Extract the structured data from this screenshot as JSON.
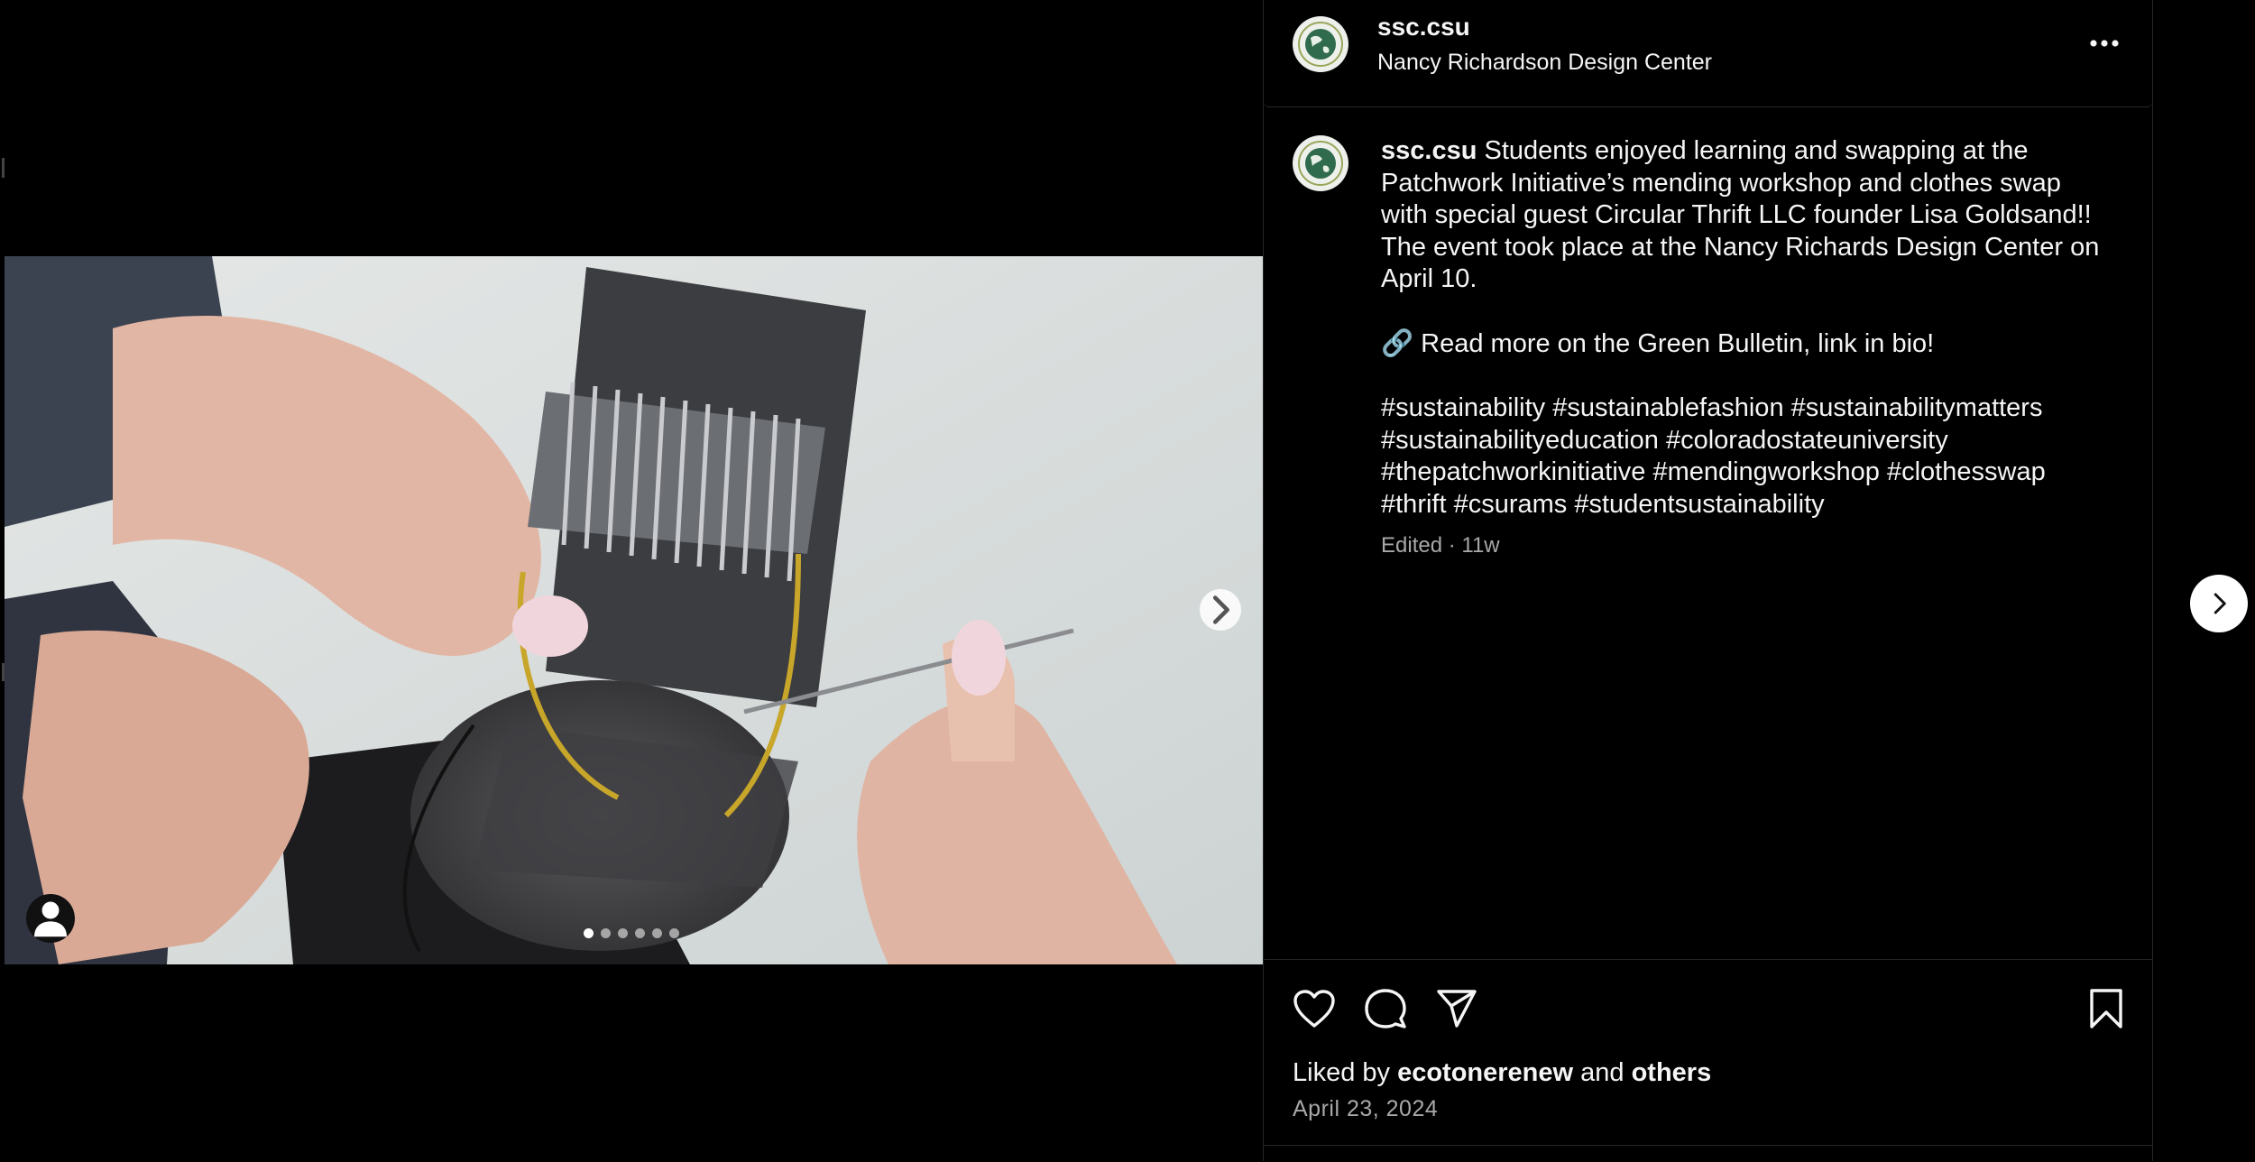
{
  "post": {
    "username": "ssc.csu",
    "location": "Nancy Richardson Design Center",
    "caption": {
      "username": "ssc.csu",
      "line1": "Students enjoyed learning and swapping at the Patchwork Initiative’s mending workshop and clothes swap with special guest Circular Thrift LLC founder Lisa Goldsand!! The event took place at the Nancy Richards Design Center on April 10.",
      "line2": "🔗 Read more on the Green Bulletin, link in bio!",
      "hashtags": "#sustainability #sustainablefashion #sustainabilitymatters #sustainabilityeducation #coloradostateuniversity #thepatchworkinitiative #mendingworkshop #clothesswap #thrift #csurams #studentsustainability"
    },
    "meta": "Edited · 11w",
    "likes": {
      "prefix": "Liked by",
      "user": "ecotonerenew",
      "and": "and",
      "others": "others"
    },
    "date": "April 23, 2024"
  },
  "carousel": {
    "total": 6,
    "active": 1
  },
  "icons": {
    "more": "more-options-icon",
    "like": "heart-icon",
    "comment": "comment-icon",
    "share": "send-icon",
    "save": "bookmark-icon",
    "carousel_next": "chevron-right-icon",
    "tag": "user-tag-icon",
    "next_post": "chevron-right-icon"
  },
  "colors": {
    "background": "#000000",
    "text": "#f5f5f5",
    "secondary_text": "#a8a8a8",
    "divider": "#262626"
  }
}
